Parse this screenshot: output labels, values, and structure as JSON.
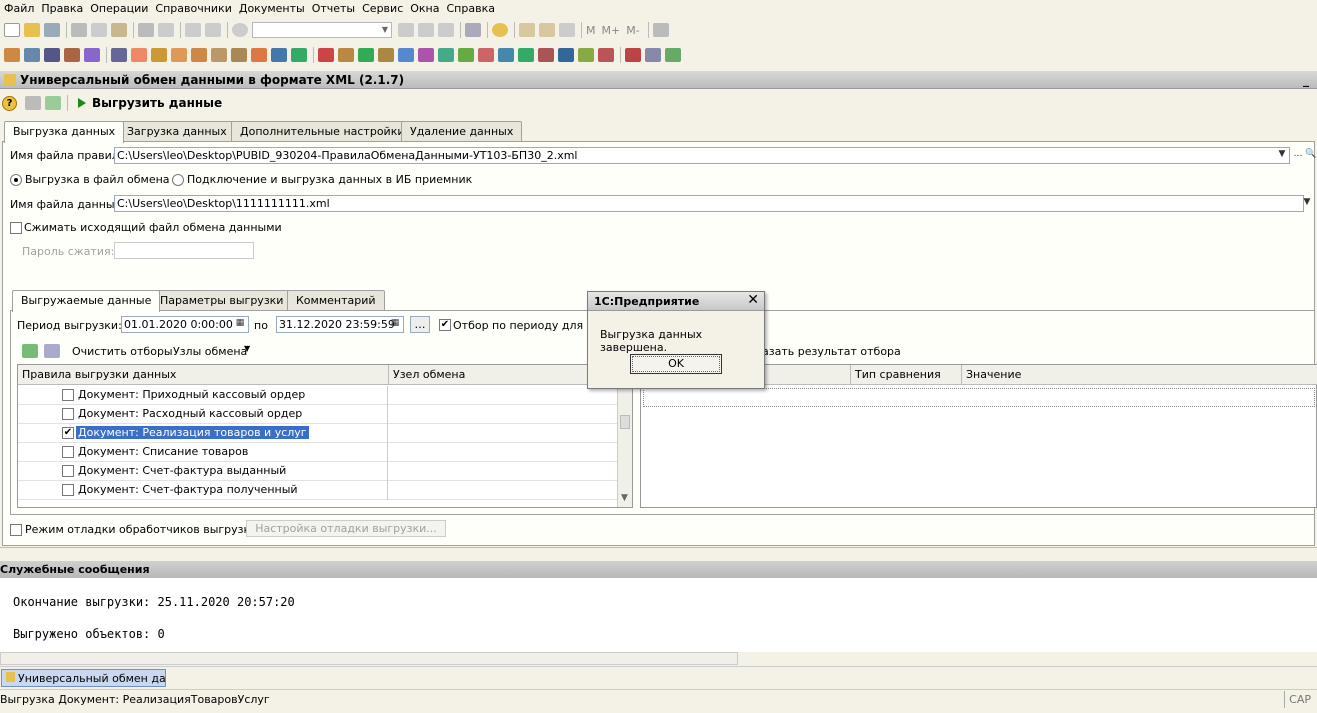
{
  "menu": [
    "Файл",
    "Правка",
    "Операции",
    "Справочники",
    "Документы",
    "Отчеты",
    "Сервис",
    "Окна",
    "Справка"
  ],
  "toolbar1": {
    "m_label": "M",
    "mplus_label": "M+",
    "mminus_label": "M-"
  },
  "window": {
    "title": "Универсальный обмен данными в формате XML (2.1.7)",
    "minimize": "_"
  },
  "commandbar": {
    "help": "?",
    "export_label": "Выгрузить данные"
  },
  "main_tabs": [
    "Выгрузка данных",
    "Загрузка данных",
    "Дополнительные настройки",
    "Удаление данных"
  ],
  "rules_file": {
    "label": "Имя файла правил:",
    "value": "C:\\Users\\leo\\Desktop\\PUBID_930204-ПравилаОбменаДанными-УТ103-БП30_2.xml"
  },
  "mode": {
    "option1": "Выгрузка в файл обмена",
    "option2": "Подключение и выгрузка данных в ИБ приемник"
  },
  "data_file": {
    "label": "Имя файла данных:",
    "value": "C:\\Users\\leo\\Desktop\\1111111111.xml"
  },
  "compress": {
    "label": "Сжимать исходящий файл обмена данными"
  },
  "password": {
    "label": "Пароль сжатия:"
  },
  "sub_tabs": [
    "Выгружаемые данные",
    "Параметры выгрузки",
    "Комментарий"
  ],
  "period": {
    "label": "Период выгрузки:",
    "from": "01.01.2020  0:00:00",
    "to_label": "по",
    "to": "31.12.2020 23:59:59",
    "filter_label": "Отбор по периоду для всех"
  },
  "list_toolbar": {
    "clear_filters": "Очистить отборы",
    "nodes": "Узлы обмена",
    "show_result": "азать результат отбора"
  },
  "tree": {
    "col_rules": "Правила выгрузки данных",
    "col_node": "Узел обмена",
    "rows": [
      {
        "label": "Документ: Приходный кассовый ордер",
        "checked": ""
      },
      {
        "label": "Документ: Расходный кассовый ордер",
        "checked": ""
      },
      {
        "label": "Документ: Реализация товаров и услуг",
        "checked": "✔"
      },
      {
        "label": "Документ: Списание товаров",
        "checked": ""
      },
      {
        "label": "Документ: Счет-фактура выданный",
        "checked": ""
      },
      {
        "label": "Документ: Счет-фактура полученный",
        "checked": ""
      }
    ]
  },
  "filter_table": {
    "col_compare": "Тип сравнения",
    "col_value": "Значение"
  },
  "debug": {
    "label": "Режим отладки обработчиков выгрузки",
    "button": "Настройка отладки выгрузки..."
  },
  "dialog": {
    "title": "1С:Предприятие",
    "close": "✕",
    "message": "Выгрузка данных завершена.",
    "ok": "OK"
  },
  "service": {
    "title": "Служебные сообщения",
    "line1": "Окончание выгрузки: 25.11.2020 20:57:20",
    "line2": "Выгружено объектов: 0"
  },
  "taskbar": {
    "item": "Универсальный обмен данн..."
  },
  "status": {
    "text": "Выгрузка Документ:  РеализацияТоваровУслуг",
    "caps": "CAP"
  },
  "colors": {
    "selection": "#3a6ec8",
    "background": "#f4f1e6",
    "titlebar": "#c8c8c8"
  }
}
